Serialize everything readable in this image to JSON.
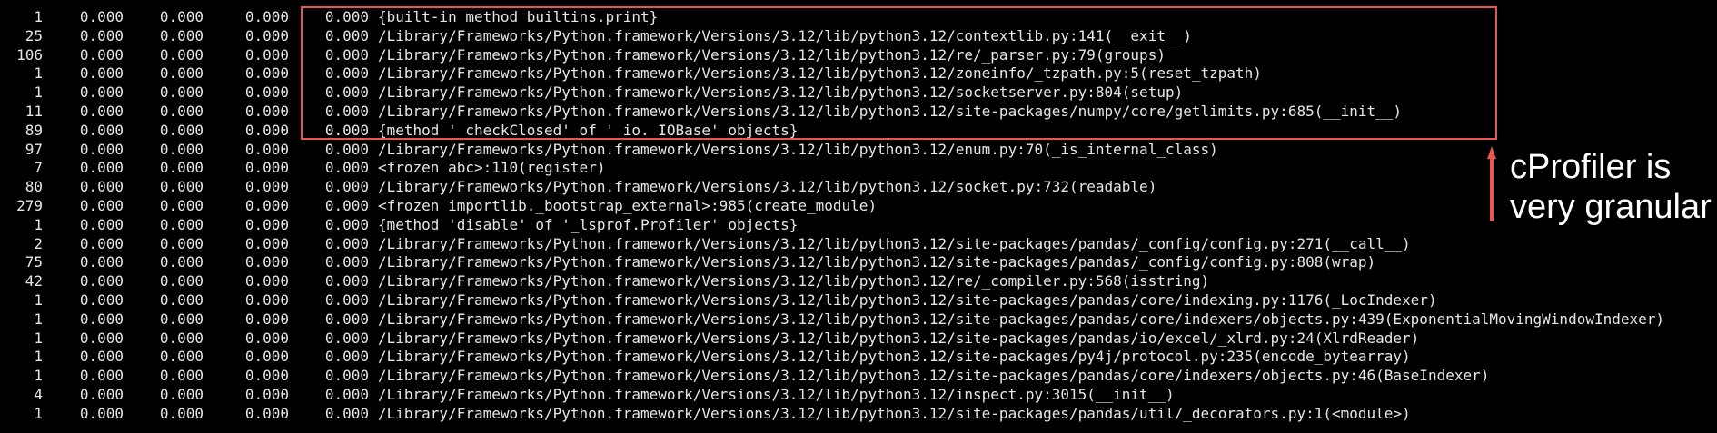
{
  "colors": {
    "background": "#000000",
    "text": "#e6e6e6",
    "highlight": "#e8574f",
    "annotation_text": "#ffffff"
  },
  "annotation": {
    "line1": "cProfiler is",
    "line2": "very granular"
  },
  "rows": [
    {
      "ncalls": "1",
      "tottime": "0.000",
      "percall": "0.000",
      "cumtime": "0.000",
      "percall2": "0.000",
      "func": "{built-in method builtins.print}"
    },
    {
      "ncalls": "25",
      "tottime": "0.000",
      "percall": "0.000",
      "cumtime": "0.000",
      "percall2": "0.000",
      "func": "/Library/Frameworks/Python.framework/Versions/3.12/lib/python3.12/contextlib.py:141(__exit__)"
    },
    {
      "ncalls": "106",
      "tottime": "0.000",
      "percall": "0.000",
      "cumtime": "0.000",
      "percall2": "0.000",
      "func": "/Library/Frameworks/Python.framework/Versions/3.12/lib/python3.12/re/_parser.py:79(groups)"
    },
    {
      "ncalls": "1",
      "tottime": "0.000",
      "percall": "0.000",
      "cumtime": "0.000",
      "percall2": "0.000",
      "func": "/Library/Frameworks/Python.framework/Versions/3.12/lib/python3.12/zoneinfo/_tzpath.py:5(reset_tzpath)"
    },
    {
      "ncalls": "1",
      "tottime": "0.000",
      "percall": "0.000",
      "cumtime": "0.000",
      "percall2": "0.000",
      "func": "/Library/Frameworks/Python.framework/Versions/3.12/lib/python3.12/socketserver.py:804(setup)"
    },
    {
      "ncalls": "11",
      "tottime": "0.000",
      "percall": "0.000",
      "cumtime": "0.000",
      "percall2": "0.000",
      "func": "/Library/Frameworks/Python.framework/Versions/3.12/lib/python3.12/site-packages/numpy/core/getlimits.py:685(__init__)"
    },
    {
      "ncalls": "89",
      "tottime": "0.000",
      "percall": "0.000",
      "cumtime": "0.000",
      "percall2": "0.000",
      "func": "{method '_checkClosed' of '_io._IOBase' objects}"
    },
    {
      "ncalls": "97",
      "tottime": "0.000",
      "percall": "0.000",
      "cumtime": "0.000",
      "percall2": "0.000",
      "func": "/Library/Frameworks/Python.framework/Versions/3.12/lib/python3.12/enum.py:70(_is_internal_class)"
    },
    {
      "ncalls": "7",
      "tottime": "0.000",
      "percall": "0.000",
      "cumtime": "0.000",
      "percall2": "0.000",
      "func": "<frozen abc>:110(register)"
    },
    {
      "ncalls": "80",
      "tottime": "0.000",
      "percall": "0.000",
      "cumtime": "0.000",
      "percall2": "0.000",
      "func": "/Library/Frameworks/Python.framework/Versions/3.12/lib/python3.12/socket.py:732(readable)"
    },
    {
      "ncalls": "279",
      "tottime": "0.000",
      "percall": "0.000",
      "cumtime": "0.000",
      "percall2": "0.000",
      "func": "<frozen importlib._bootstrap_external>:985(create_module)"
    },
    {
      "ncalls": "1",
      "tottime": "0.000",
      "percall": "0.000",
      "cumtime": "0.000",
      "percall2": "0.000",
      "func": "{method 'disable' of '_lsprof.Profiler' objects}"
    },
    {
      "ncalls": "2",
      "tottime": "0.000",
      "percall": "0.000",
      "cumtime": "0.000",
      "percall2": "0.000",
      "func": "/Library/Frameworks/Python.framework/Versions/3.12/lib/python3.12/site-packages/pandas/_config/config.py:271(__call__)"
    },
    {
      "ncalls": "75",
      "tottime": "0.000",
      "percall": "0.000",
      "cumtime": "0.000",
      "percall2": "0.000",
      "func": "/Library/Frameworks/Python.framework/Versions/3.12/lib/python3.12/site-packages/pandas/_config/config.py:808(wrap)"
    },
    {
      "ncalls": "42",
      "tottime": "0.000",
      "percall": "0.000",
      "cumtime": "0.000",
      "percall2": "0.000",
      "func": "/Library/Frameworks/Python.framework/Versions/3.12/lib/python3.12/re/_compiler.py:568(isstring)"
    },
    {
      "ncalls": "1",
      "tottime": "0.000",
      "percall": "0.000",
      "cumtime": "0.000",
      "percall2": "0.000",
      "func": "/Library/Frameworks/Python.framework/Versions/3.12/lib/python3.12/site-packages/pandas/core/indexing.py:1176(_LocIndexer)"
    },
    {
      "ncalls": "1",
      "tottime": "0.000",
      "percall": "0.000",
      "cumtime": "0.000",
      "percall2": "0.000",
      "func": "/Library/Frameworks/Python.framework/Versions/3.12/lib/python3.12/site-packages/pandas/core/indexers/objects.py:439(ExponentialMovingWindowIndexer)"
    },
    {
      "ncalls": "1",
      "tottime": "0.000",
      "percall": "0.000",
      "cumtime": "0.000",
      "percall2": "0.000",
      "func": "/Library/Frameworks/Python.framework/Versions/3.12/lib/python3.12/site-packages/pandas/io/excel/_xlrd.py:24(XlrdReader)"
    },
    {
      "ncalls": "1",
      "tottime": "0.000",
      "percall": "0.000",
      "cumtime": "0.000",
      "percall2": "0.000",
      "func": "/Library/Frameworks/Python.framework/Versions/3.12/lib/python3.12/site-packages/py4j/protocol.py:235(encode_bytearray)"
    },
    {
      "ncalls": "1",
      "tottime": "0.000",
      "percall": "0.000",
      "cumtime": "0.000",
      "percall2": "0.000",
      "func": "/Library/Frameworks/Python.framework/Versions/3.12/lib/python3.12/site-packages/pandas/core/indexers/objects.py:46(BaseIndexer)"
    },
    {
      "ncalls": "4",
      "tottime": "0.000",
      "percall": "0.000",
      "cumtime": "0.000",
      "percall2": "0.000",
      "func": "/Library/Frameworks/Python.framework/Versions/3.12/lib/python3.12/inspect.py:3015(__init__)"
    },
    {
      "ncalls": "1",
      "tottime": "0.000",
      "percall": "0.000",
      "cumtime": "0.000",
      "percall2": "0.000",
      "func": "/Library/Frameworks/Python.framework/Versions/3.12/lib/python3.12/site-packages/pandas/util/_decorators.py:1(<module>)"
    }
  ]
}
